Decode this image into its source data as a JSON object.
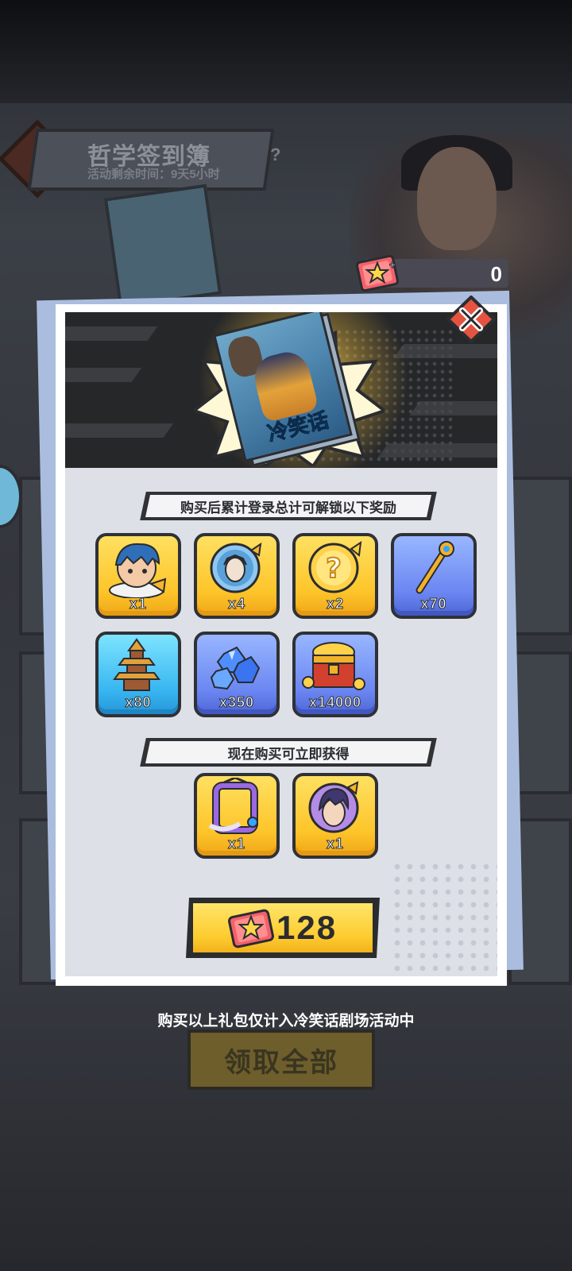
{
  "background": {
    "title": "哲学签到簿",
    "subtitle": "活动剩余时间：9天5小时",
    "help": "?",
    "claim_all": "领取全部"
  },
  "currency": {
    "icon": "star-ticket-icon",
    "value": "0"
  },
  "popup": {
    "book_title": "冷笑话",
    "section1_title": "购买后累计登录总计可解锁以下奖励",
    "rewards": [
      {
        "icon": "hero-portrait-icon",
        "qty": "x1",
        "frame": "gold"
      },
      {
        "icon": "hero-emblem-icon",
        "qty": "x4",
        "frame": "gold"
      },
      {
        "icon": "mystery-coin-icon",
        "qty": "x2",
        "frame": "gold"
      },
      {
        "icon": "golden-scepter-icon",
        "qty": "x70",
        "frame": "blue"
      },
      {
        "icon": "pagoda-icon",
        "qty": "x80",
        "frame": "cyan"
      },
      {
        "icon": "blue-crystals-icon",
        "qty": "x350",
        "frame": "blue"
      },
      {
        "icon": "treasure-chest-icon",
        "qty": "x14000",
        "frame": "blue"
      }
    ],
    "section2_title": "现在购买可立即获得",
    "instant_rewards": [
      {
        "icon": "avatar-frame-icon",
        "qty": "x1",
        "frame": "gold"
      },
      {
        "icon": "hero-avatar-icon",
        "qty": "x1",
        "frame": "gold"
      }
    ],
    "buy_price": "128",
    "close_icon": "close-icon"
  },
  "footnote": "购买以上礼包仅计入冷笑话剧场活动中",
  "colors": {
    "gold": "#fdc52a",
    "blue": "#6b87f2",
    "cyan": "#38b6f0",
    "dark": "#2a2c30"
  }
}
